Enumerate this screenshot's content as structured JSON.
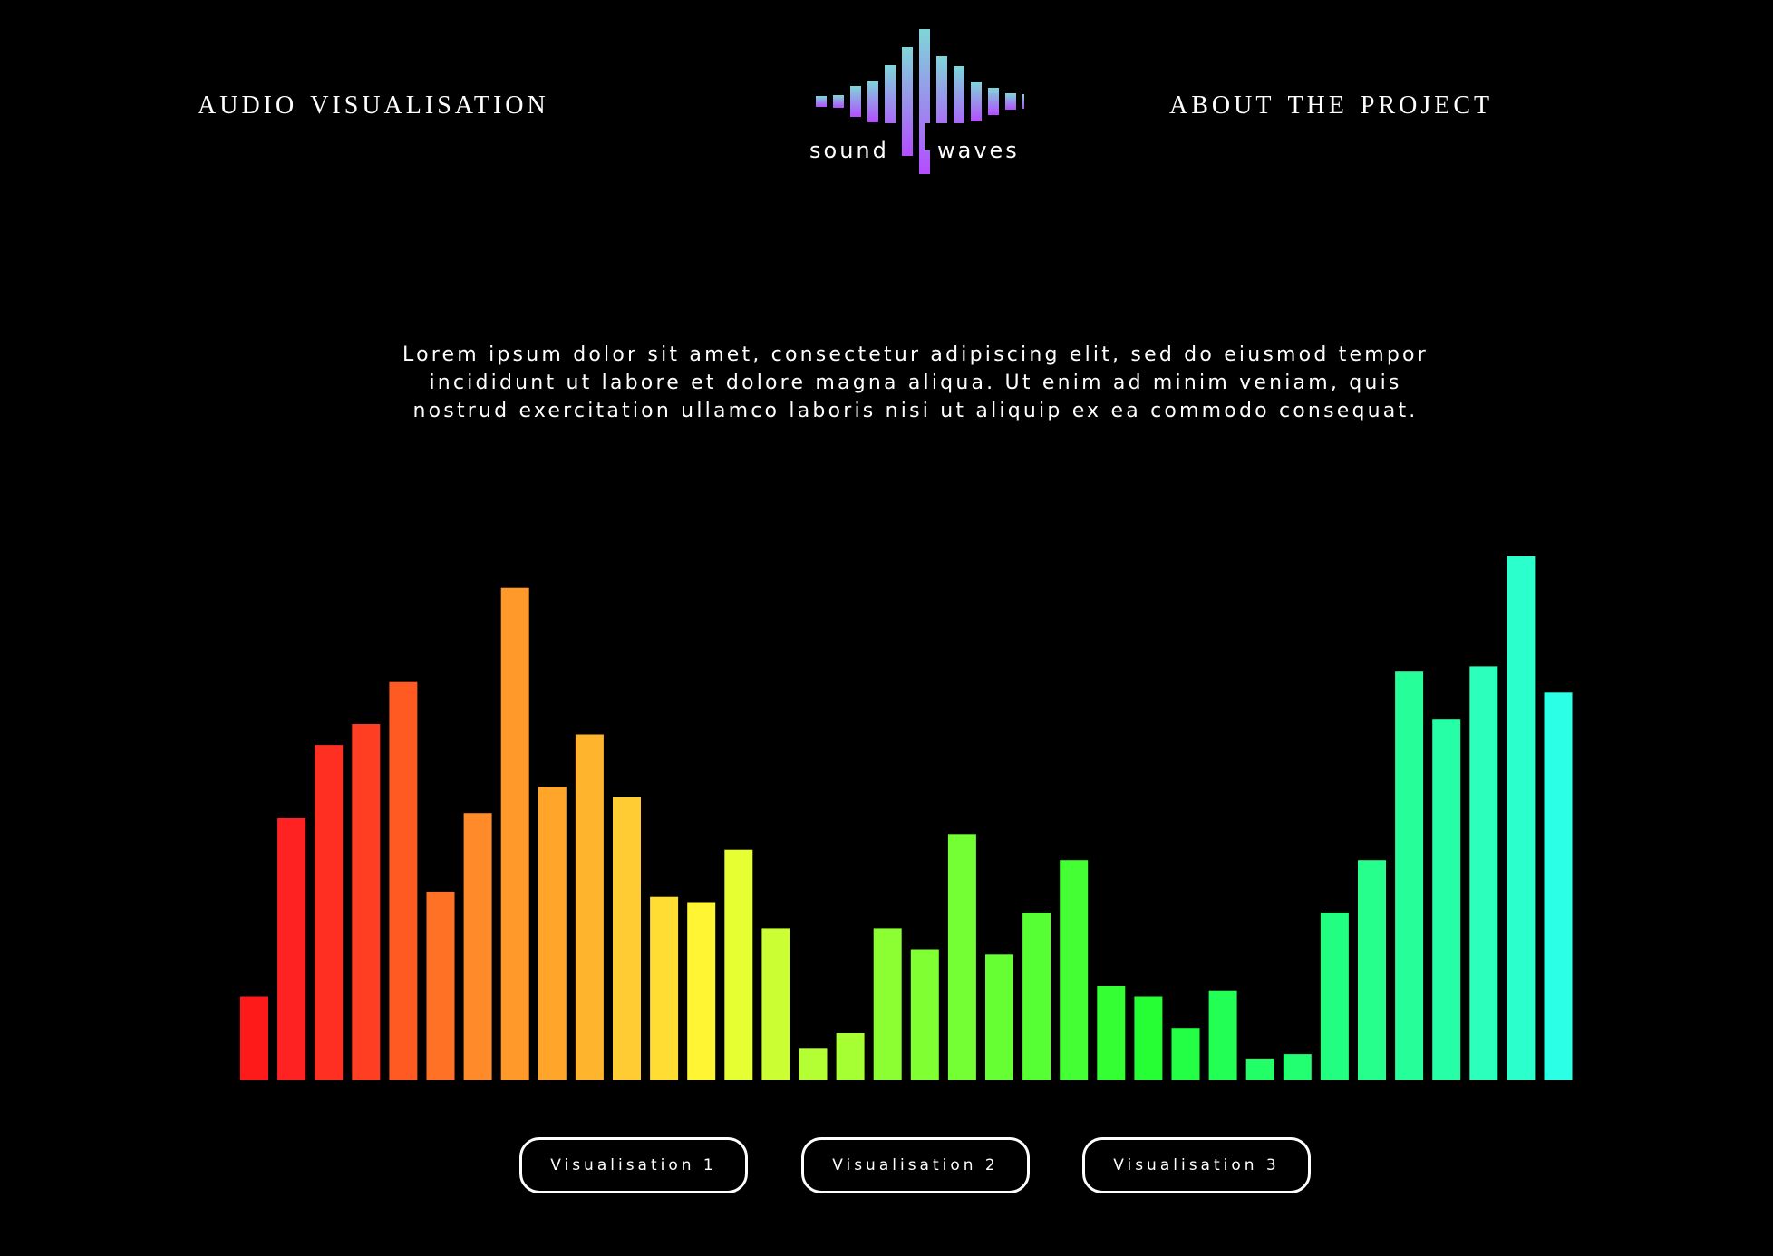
{
  "nav": {
    "left_label": "Audio Visualisation",
    "right_label": "About the Project"
  },
  "logo": {
    "word_1": "sound",
    "word_2": "waves",
    "colors": [
      "#b44dff",
      "#7fd6d8"
    ],
    "icon": "sound-wave-logo"
  },
  "intro": {
    "text": "Lorem ipsum dolor sit amet, consectetur adipiscing elit, sed do eiusmod tempor incididunt ut labore et dolore magna aliqua. Ut enim ad minim veniam, quis nostrud exercitation ullamco laboris nisi ut aliquip ex ea commodo consequat."
  },
  "visualiser": {
    "levels": [
      0.16,
      0.5,
      0.64,
      0.68,
      0.76,
      0.36,
      0.51,
      0.94,
      0.56,
      0.66,
      0.54,
      0.35,
      0.34,
      0.44,
      0.29,
      0.06,
      0.09,
      0.29,
      0.25,
      0.47,
      0.24,
      0.32,
      0.42,
      0.18,
      0.16,
      0.1,
      0.17,
      0.04,
      0.05,
      0.32,
      0.42,
      0.78,
      0.69,
      0.79,
      1.0,
      0.74
    ],
    "colors": [
      "#ff1a1a",
      "#ff2222",
      "#ff2f22",
      "#ff3e22",
      "#ff5a22",
      "#ff7226",
      "#ff8a2a",
      "#ff9a2a",
      "#ffa62a",
      "#ffb42e",
      "#ffcc33",
      "#ffdd33",
      "#fff533",
      "#e6ff33",
      "#ccff33",
      "#b3ff33",
      "#a6ff33",
      "#8cff33",
      "#80ff33",
      "#73ff33",
      "#66ff33",
      "#55ff33",
      "#44ff33",
      "#33ff33",
      "#26ff33",
      "#22ff44",
      "#22ff55",
      "#22ff66",
      "#22ff70",
      "#22ff80",
      "#26ff8c",
      "#26ff99",
      "#26ffa6",
      "#2bffbb",
      "#2bffcc",
      "#2bffe6"
    ]
  },
  "buttons": [
    {
      "label": "Visualisation 1"
    },
    {
      "label": "Visualisation 2"
    },
    {
      "label": "Visualisation 3"
    }
  ]
}
